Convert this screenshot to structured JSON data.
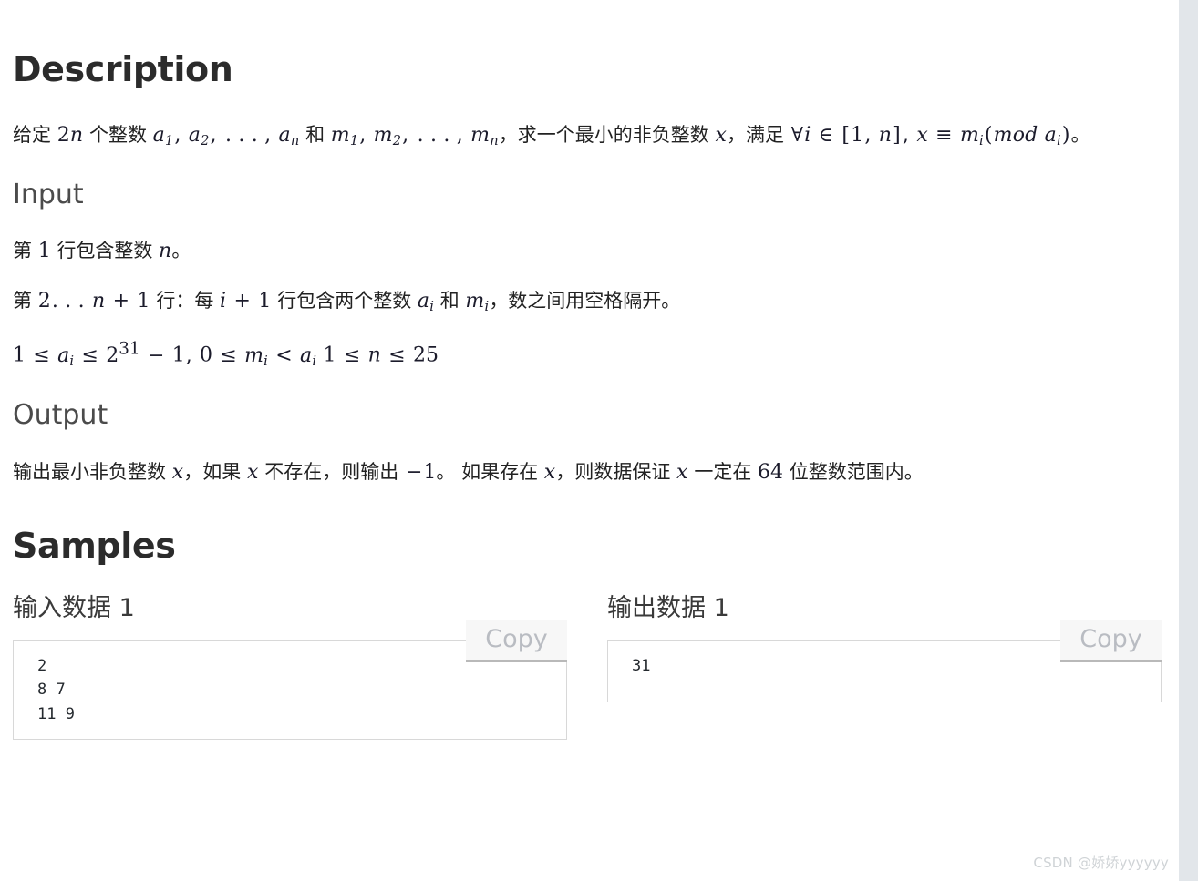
{
  "page": {
    "background": "#ffffff",
    "gutter_color": "#e2e6ea"
  },
  "description": {
    "heading": "Description",
    "paragraph": {
      "t1": "给定 ",
      "m1": "2n",
      "t2": " 个整数 ",
      "m2": "a₁, a₂, …, aₙ",
      "t3": " 和 ",
      "m3": "m₁, m₂, …, mₙ",
      "t4": "，求一个最小的非负整数 ",
      "m4": "x",
      "t5": "，满足 ",
      "m5": "∀i ∈ [1, n], x ≡ mᵢ (mod aᵢ)",
      "t6": "。",
      "plain": "给定 2n 个整数 a1,a2,…,an 和 m1,m2,…,mn，求一个最小的非负整数 x，满足 ∀i∈[1,n], x ≡ mi (mod ai)。"
    }
  },
  "input": {
    "heading": "Input",
    "line1": {
      "t1": "第 ",
      "m1": "1",
      "t2": " 行包含整数 ",
      "m2": "n",
      "t3": "。"
    },
    "line2": {
      "t1": "第 ",
      "m1": "2 … n + 1",
      "t2": " 行：每 ",
      "m2": "i + 1",
      "t3": " 行包含两个整数 ",
      "m3": "aᵢ",
      "t4": " 和 ",
      "m4": "mᵢ",
      "t5": "，数之间用空格隔开。"
    },
    "constraints": "1 ≤ ai ≤ 2^31 − 1, 0 ≤ mi < ai  1 ≤ n ≤ 25"
  },
  "output": {
    "heading": "Output",
    "line1": {
      "t1": "输出最小非负整数 ",
      "m1": "x",
      "t2": "，如果 ",
      "m2": "x",
      "t3": " 不存在，则输出 ",
      "m3": "−1",
      "t4": "。 如果存在 ",
      "m4": "x",
      "t5": "，则数据保证 ",
      "m5": "x",
      "t6": " 一定在 ",
      "m6": "64",
      "t7": " 位整数范围内。"
    }
  },
  "samples": {
    "heading": "Samples",
    "copy_label": "Copy",
    "items": [
      {
        "title": "输入数据 1",
        "code": "2\n8 7\n11 9"
      },
      {
        "title": "输出数据 1",
        "code": "31"
      }
    ]
  },
  "watermark": {
    "text": "CSDN @娇娇yyyyyy"
  }
}
